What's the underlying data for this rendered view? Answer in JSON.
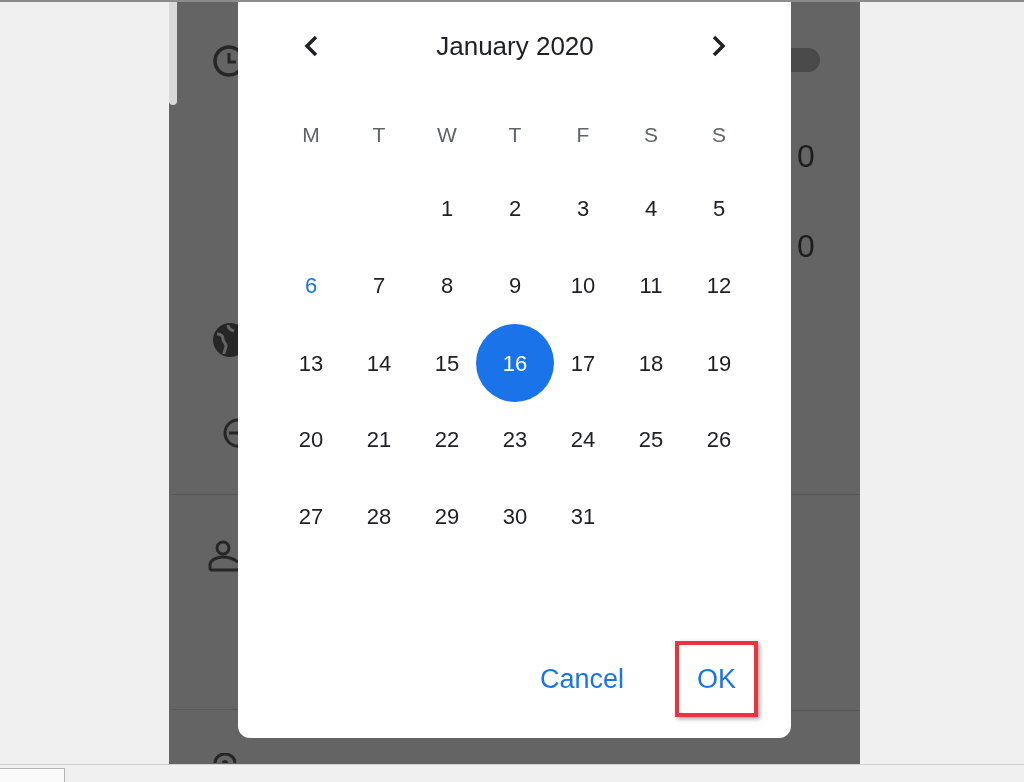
{
  "background": {
    "values": [
      "0",
      "0"
    ]
  },
  "date_picker": {
    "title": "January 2020",
    "weekdays": [
      "M",
      "T",
      "W",
      "T",
      "F",
      "S",
      "S"
    ],
    "weeks": [
      [
        {
          "label": "1",
          "today": false,
          "selected": false
        },
        {
          "label": "2",
          "today": false,
          "selected": false
        },
        {
          "label": "3",
          "today": false,
          "selected": false
        },
        {
          "label": "4",
          "today": false,
          "selected": false
        },
        {
          "label": "5",
          "today": false,
          "selected": false
        }
      ],
      [
        {
          "label": "6",
          "today": true,
          "selected": false
        },
        {
          "label": "7",
          "today": false,
          "selected": false
        },
        {
          "label": "8",
          "today": false,
          "selected": false
        },
        {
          "label": "9",
          "today": false,
          "selected": false
        },
        {
          "label": "10",
          "today": false,
          "selected": false
        },
        {
          "label": "11",
          "today": false,
          "selected": false
        },
        {
          "label": "12",
          "today": false,
          "selected": false
        }
      ],
      [
        {
          "label": "13",
          "today": false,
          "selected": false
        },
        {
          "label": "14",
          "today": false,
          "selected": false
        },
        {
          "label": "15",
          "today": false,
          "selected": false
        },
        {
          "label": "16",
          "today": false,
          "selected": true
        },
        {
          "label": "17",
          "today": false,
          "selected": false
        },
        {
          "label": "18",
          "today": false,
          "selected": false
        },
        {
          "label": "19",
          "today": false,
          "selected": false
        }
      ],
      [
        {
          "label": "20",
          "today": false,
          "selected": false
        },
        {
          "label": "21",
          "today": false,
          "selected": false
        },
        {
          "label": "22",
          "today": false,
          "selected": false
        },
        {
          "label": "23",
          "today": false,
          "selected": false
        },
        {
          "label": "24",
          "today": false,
          "selected": false
        },
        {
          "label": "25",
          "today": false,
          "selected": false
        },
        {
          "label": "26",
          "today": false,
          "selected": false
        }
      ],
      [
        {
          "label": "27",
          "today": false,
          "selected": false
        },
        {
          "label": "28",
          "today": false,
          "selected": false
        },
        {
          "label": "29",
          "today": false,
          "selected": false
        },
        {
          "label": "30",
          "today": false,
          "selected": false
        },
        {
          "label": "31",
          "today": false,
          "selected": false
        }
      ]
    ],
    "buttons": [
      {
        "label": "Cancel",
        "highlighted": false
      },
      {
        "label": "OK",
        "highlighted": true
      }
    ]
  }
}
